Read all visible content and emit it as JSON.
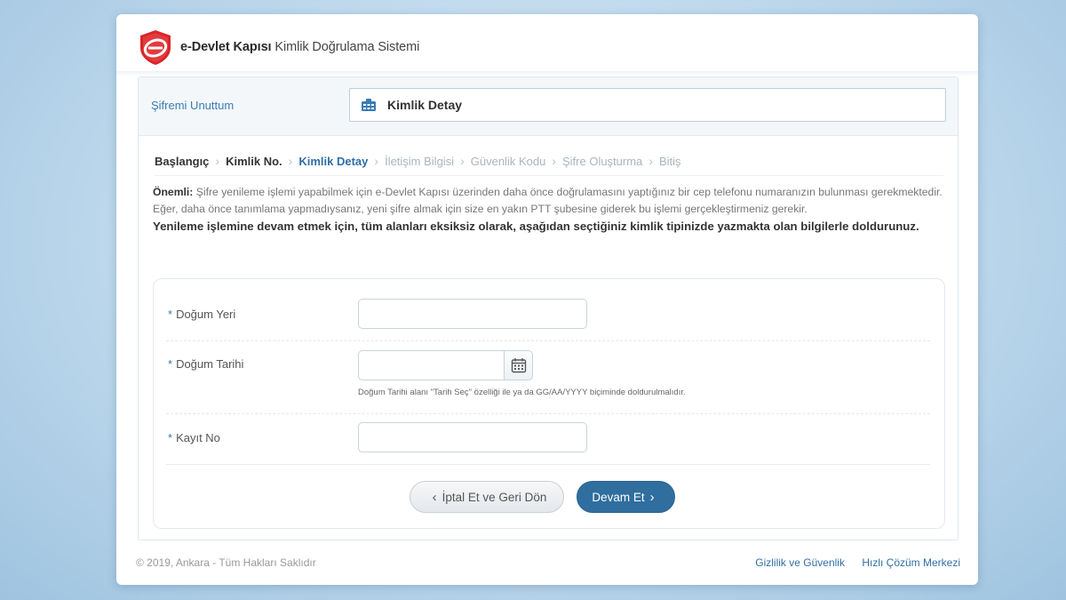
{
  "brand": {
    "name_bold": "e-Devlet Kapısı",
    "name_rest": "Kimlik Doğrulama Sistemi",
    "logo_icon": "e-devlet-logo-icon"
  },
  "topbar": {
    "forgot_link": "Şifremi Unuttum",
    "current_step_title": "Kimlik Detay",
    "step_icon": "id-card-icon"
  },
  "breadcrumb": {
    "steps": [
      {
        "label": "Başlangıç",
        "state": "done"
      },
      {
        "label": "Kimlik No.",
        "state": "done"
      },
      {
        "label": "Kimlik Detay",
        "state": "active"
      },
      {
        "label": "İletişim Bilgisi",
        "state": "pending"
      },
      {
        "label": "Güvenlik Kodu",
        "state": "pending"
      },
      {
        "label": "Şifre Oluşturma",
        "state": "pending"
      },
      {
        "label": "Bitiş",
        "state": "pending"
      }
    ]
  },
  "notice": {
    "label": "Önemli:",
    "text": "Şifre yenileme işlemi yapabilmek için e-Devlet Kapısı üzerinden daha önce doğrulamasını yaptığınız bir cep telefonu numaranızın bulunması gerekmektedir. Eğer, daha önce tanımlama yapmadıysanız, yeni şifre almak için size en yakın PTT şubesine giderek bu işlemi gerçekleştirmeniz gerekir.",
    "strong": "Yenileme işlemine devam etmek için, tüm alanları eksiksiz olarak, aşağıdan seçtiğiniz kimlik tipinizde yazmakta olan bilgilerle doldurunuz."
  },
  "form": {
    "required_mark": "*",
    "birth_place": {
      "label": "Doğum Yeri",
      "value": ""
    },
    "birth_date": {
      "label": "Doğum Tarihi",
      "value": "",
      "hint": "Doğum Tarihi alanı \"Tarih Seç\" özelliği ile ya da GG/AA/YYYY biçiminde doldurulmalıdır.",
      "picker_icon": "calendar-icon"
    },
    "record_no": {
      "label": "Kayıt No",
      "value": ""
    }
  },
  "actions": {
    "cancel": "İptal Et ve Geri Dön",
    "next": "Devam Et"
  },
  "footer": {
    "copyright": "© 2019, Ankara - Tüm Hakları Saklıdır",
    "links": [
      "Gizlilik ve Güvenlik",
      "Hızlı Çözüm Merkezi"
    ]
  },
  "colors": {
    "primary": "#2f6e9e",
    "link": "#2f6fa6",
    "logo_red": "#d8262b"
  }
}
